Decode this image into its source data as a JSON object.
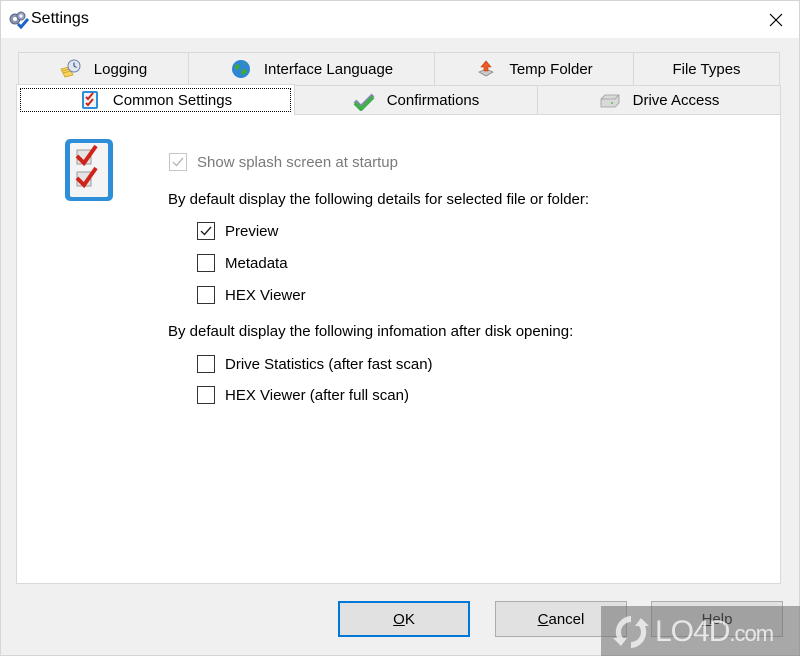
{
  "window": {
    "title": "Settings",
    "app_icon": "settings-gears-icon",
    "close_icon": "close-icon"
  },
  "tabs": {
    "row_back": [
      {
        "label": "Logging",
        "icon": "logging-clock-icon"
      },
      {
        "label": "Interface Language",
        "icon": "globe-icon"
      },
      {
        "label": "Temp Folder",
        "icon": "temp-folder-icon"
      },
      {
        "label": "File Types",
        "icon": ""
      }
    ],
    "row_front": [
      {
        "label": "Common Settings",
        "icon": "checklist-icon",
        "active": true
      },
      {
        "label": "Confirmations",
        "icon": "checkmark-icon",
        "active": false
      },
      {
        "label": "Drive Access",
        "icon": "drive-icon",
        "active": false
      }
    ]
  },
  "panel": {
    "icon": "checklist-large-icon",
    "splash": {
      "label": "Show splash screen at startup",
      "checked": true,
      "disabled": true
    },
    "details_heading": "By default display the following details for selected file or folder:",
    "details_options": [
      {
        "label": "Preview",
        "checked": true
      },
      {
        "label": "Metadata",
        "checked": false
      },
      {
        "label": "HEX Viewer",
        "checked": false
      }
    ],
    "disk_heading": "By default display the following infomation after disk opening:",
    "disk_options": [
      {
        "label": "Drive Statistics (after fast scan)",
        "checked": false
      },
      {
        "label": "HEX Viewer (after full scan)",
        "checked": false
      }
    ]
  },
  "buttons": {
    "ok": {
      "mnemonic": "O",
      "rest": "K"
    },
    "cancel": {
      "mnemonic": "C",
      "rest": "ancel"
    },
    "help": {
      "mnemonic": "H",
      "rest": "elp"
    }
  },
  "watermark": {
    "text": "LO4D",
    "suffix": ".com"
  },
  "colors": {
    "accent": "#0078d7",
    "panel_bg": "#ffffff",
    "window_bg": "#f0f0f0",
    "check_red": "#d0241b",
    "icon_blue": "#2e8fd8"
  }
}
